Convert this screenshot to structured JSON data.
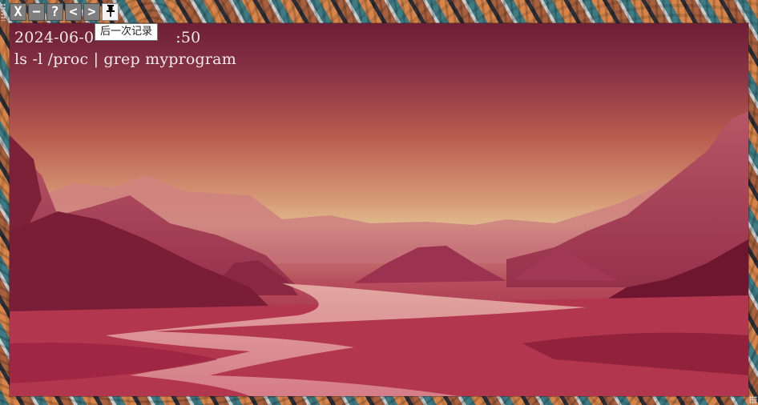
{
  "window": {
    "toolbar": {
      "close": {
        "label": "X"
      },
      "minimize": {
        "label": "−"
      },
      "help": {
        "label": "?"
      },
      "prev": {
        "label": "<"
      },
      "next": {
        "label": ">"
      },
      "pin": {
        "icon": "pushpin-icon"
      }
    },
    "tooltip": "后一次记录"
  },
  "log": {
    "timestamp": "2024-06-0",
    "timestamp_tail": ":50",
    "command": "ls -l /proc | grep myprogram"
  },
  "colors": {
    "button_bg": "#7f7f7f",
    "text": "#f3ece6",
    "sky_top": "#6c1f36",
    "horizon": "#e0b88c",
    "river": "#d9848f"
  }
}
